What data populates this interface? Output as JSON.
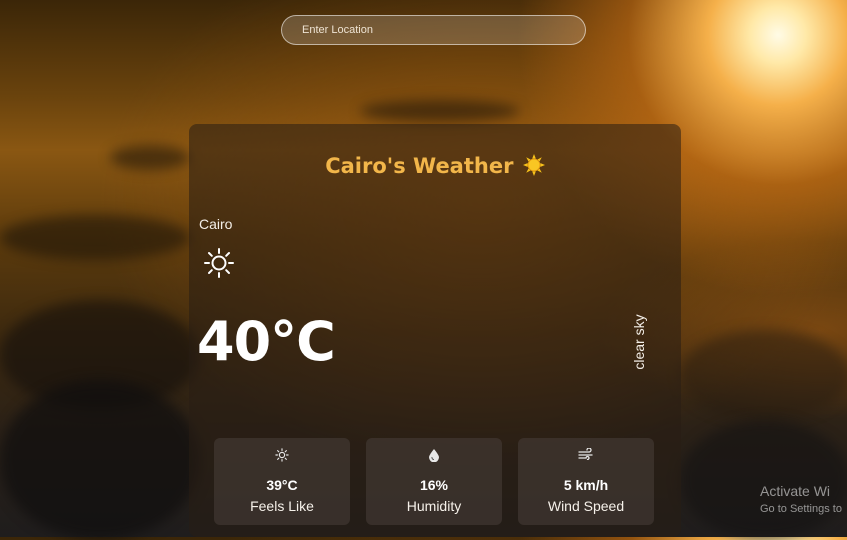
{
  "search": {
    "placeholder": "Enter Location"
  },
  "card": {
    "title": "Cairo's Weather",
    "city": "Cairo",
    "temperature": "40°C",
    "description": "clear sky",
    "stats": [
      {
        "icon": "sun-icon",
        "value": "39°C",
        "label": "Feels Like"
      },
      {
        "icon": "droplet-icon",
        "value": "16%",
        "label": "Humidity"
      },
      {
        "icon": "wind-icon",
        "value": "5 km/h",
        "label": "Wind Speed"
      }
    ]
  },
  "watermark": {
    "line1": "Activate Wi",
    "line2": "Go to Settings to"
  },
  "colors": {
    "title": "#f2b64a",
    "sun_emoji": "#f7c21b"
  }
}
